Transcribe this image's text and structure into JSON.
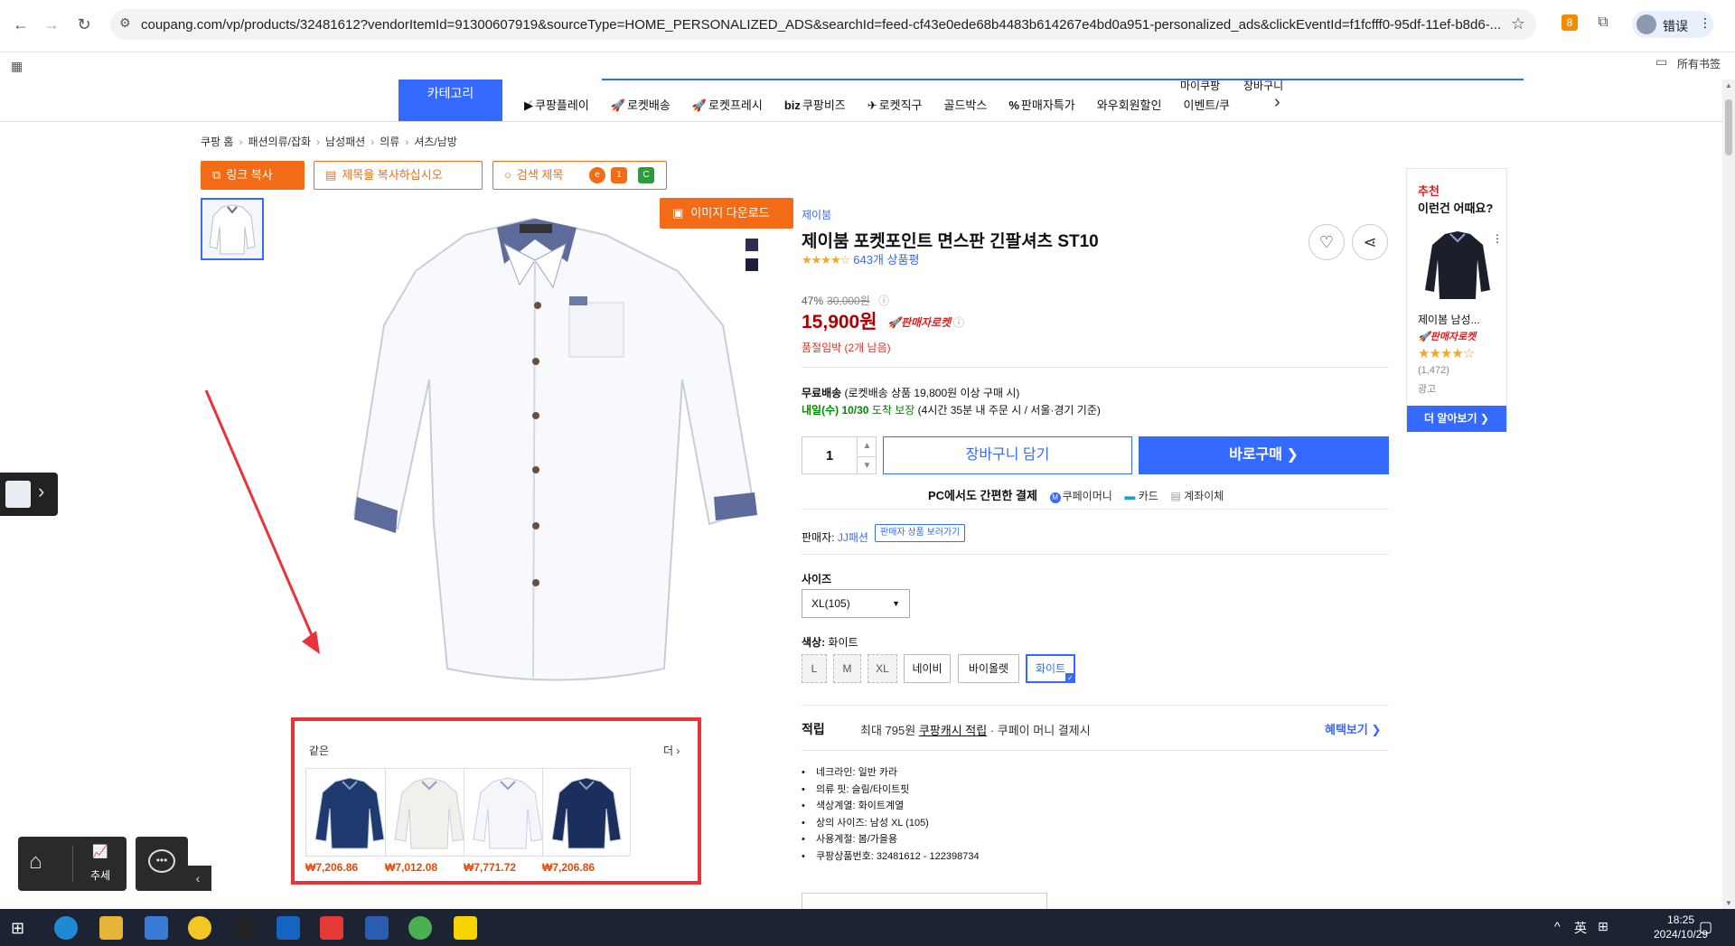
{
  "browser": {
    "url": "coupang.com/vp/products/32481612?vendorItemId=91300607919&sourceType=HOME_PERSONALIZED_ADS&searchId=feed-cf43e0ede68b4483b614267e4bd0a951-personalized_ads&clickEventId=f1fcfff0-95df-11ef-b8d6-...",
    "profile_label": "错误",
    "bookmarks_label": "所有书签",
    "ext_badge": "8"
  },
  "header": {
    "category_label": "카테고리",
    "top_links": [
      "마이쿠팡",
      "장바구니"
    ],
    "nav": [
      {
        "icon": "▶",
        "label": "쿠팡플레이"
      },
      {
        "icon": "🚀",
        "label": "로켓배송"
      },
      {
        "icon": "🚀",
        "label": "로켓프레시"
      },
      {
        "icon": "biz",
        "label": "쿠팡비즈"
      },
      {
        "icon": "✈",
        "label": "로켓직구"
      },
      {
        "icon": "",
        "label": "골드박스"
      },
      {
        "icon": "%",
        "label": "판매자특가"
      },
      {
        "icon": "",
        "label": "와우회원할인"
      },
      {
        "icon": "",
        "label": "이벤트/쿠"
      }
    ]
  },
  "breadcrumb": [
    "쿠팡 홈",
    "패션의류/잡화",
    "남성패션",
    "의류",
    "셔츠/남방"
  ],
  "actions": {
    "copy_link": "링크 복사",
    "copy_title": "제목을 복사하십시오",
    "search_title": "검색 제목",
    "image_download": "이미지 다운로드"
  },
  "similar": {
    "title": "같은",
    "more": "더",
    "items": [
      {
        "price": "₩7,206.86",
        "color": "#1f3a6e"
      },
      {
        "price": "₩7,012.08",
        "color": "#f2f0ea"
      },
      {
        "price": "₩7,771.72",
        "color": "#f4f6fb"
      },
      {
        "price": "₩7,206.86",
        "color": "#1a2f5c"
      }
    ]
  },
  "product": {
    "brand": "제이붐",
    "title": "제이붐 포켓포인트 면스판 긴팔셔츠 ST10",
    "stars": "★★★★☆",
    "rating_count": "643개 상품평",
    "discount": "47%",
    "original_price": "30,000원",
    "price": "15,900원",
    "seller_rocket": "🚀판매자로켓",
    "stock": "품절임박 (2개 남음)",
    "ship_free_label": "무료배송",
    "ship_free_note": "(로켓배송 상품 19,800원 이상 구매 시)",
    "ship_date": "내일(수) 10/30",
    "ship_guarantee": "도착 보장",
    "ship_note": "(4시간 35분  내 주문 시 / 서울·경기 기준)",
    "quantity": "1",
    "cart_label": "장바구니 담기",
    "buy_label": "바로구매 ❯",
    "pay_title": "PC에서도 간편한 결제",
    "pay_options": [
      "쿠페이머니",
      "카드",
      "계좌이체"
    ],
    "seller_label": "판매자:",
    "seller_name": "JJ패션",
    "seller_link": "판매자 상품 보러가기",
    "size_label": "사이즈",
    "size_value": "XL(105)",
    "color_label": "색상:",
    "color_value": "화이트",
    "options": [
      "L",
      "M",
      "XL",
      "네이비",
      "바이올렛",
      "화이트"
    ],
    "points_label": "적립",
    "points_prefix": "최대 795원",
    "points_link": "쿠팡캐시 적립",
    "points_suffix": "· 쿠페이 머니 결제시",
    "benefit_link": "혜택보기 ❯",
    "attributes": [
      "네크라인: 일반 카라",
      "의류 핏: 슬림/타이트핏",
      "색상계열: 화이트계열",
      "상의 사이즈: 남성 XL (105)",
      "사용계절: 봄/가을용",
      "쿠팡상품번호: 32481612 - 122398734"
    ]
  },
  "recommend": {
    "head1": "추천",
    "head2": "이런건 어때요?",
    "name": "제이봄 남성...",
    "rocket": "🚀판매자로켓",
    "stars": "★★★★☆",
    "count": "(1,472)",
    "ad": "광고",
    "more": "더 알아보기 ❯"
  },
  "widgets": {
    "trend": "추세"
  },
  "taskbar": {
    "lang": "英",
    "time": "18:25",
    "date": "2024/10/29"
  }
}
